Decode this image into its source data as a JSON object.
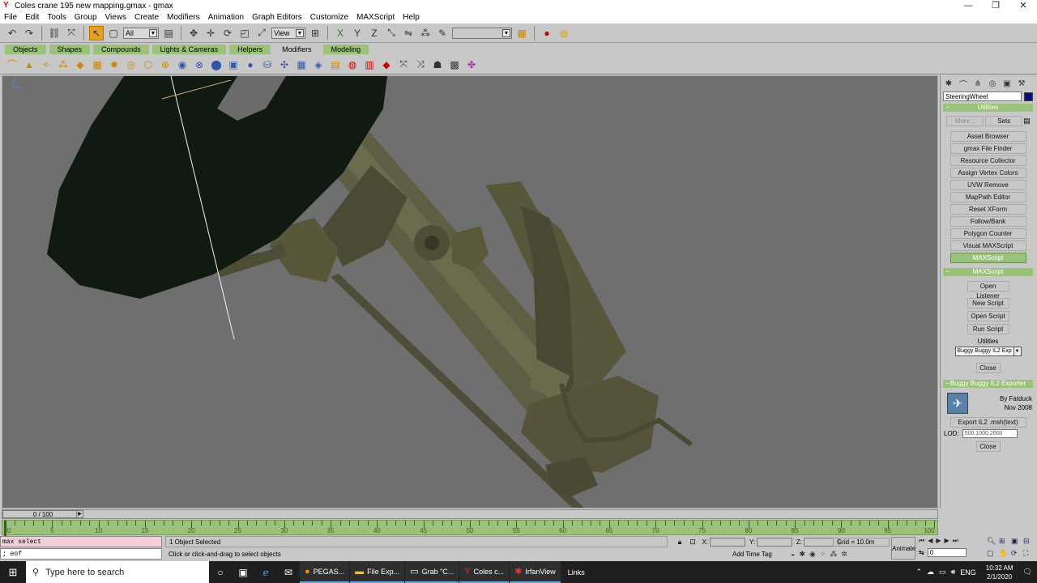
{
  "window": {
    "title": "Coles crane 195 new mapping.gmax - gmax",
    "minimize": "—",
    "restore": "❐",
    "close": "✕"
  },
  "menu": [
    "File",
    "Edit",
    "Tools",
    "Group",
    "Views",
    "Create",
    "Modifiers",
    "Animation",
    "Graph Editors",
    "Customize",
    "MAXScript",
    "Help"
  ],
  "toolbar": {
    "selection_filter": "All",
    "reference_coord": "View",
    "named_selection": ""
  },
  "tabs": [
    "Objects",
    "Shapes",
    "Compounds",
    "Lights & Cameras",
    "Helpers",
    "Modifiers",
    "Modeling"
  ],
  "active_tab": "Modifiers",
  "command_panel": {
    "object_name": "SteeringWheel",
    "object_color": "#0a0a8c",
    "utilities_rollout": "Utilities",
    "more_button": "More...",
    "sets_button": "Sets",
    "utility_buttons": [
      "Asset Browser",
      "gmax File Finder",
      "Resource Collector",
      "Assign Vertex Colors",
      "UVW Remove",
      "MapPath Editor",
      "Reset XForm",
      "Follow/Bank",
      "Polygon Counter",
      "Visual MAXScript",
      "MAXScript"
    ],
    "active_utility": "MAXScript",
    "maxscript_rollout": "MAXScript",
    "maxscript_buttons": [
      "Open Listener",
      "New Script",
      "Open Script",
      "Run Script"
    ],
    "utilities_label": "Utilities",
    "utilities_dropdown": "Buggy Buggy IL2 Exp",
    "close_button": "Close",
    "exporter_rollout": "Buggy Buggy IL2 Exporter",
    "author": "By Fatduck",
    "date": "Nov 2008",
    "export_button": "Export IL2 .msh(text)",
    "lod_label": "LOD:",
    "lod_value": "500,1000,2000",
    "exporter_close": "Close"
  },
  "timeline": {
    "frame_display": "0 / 100",
    "labels": [
      "0",
      "5",
      "10",
      "15",
      "20",
      "25",
      "30",
      "35",
      "40",
      "45",
      "50",
      "55",
      "60",
      "65",
      "70",
      "75",
      "80",
      "85",
      "90",
      "95",
      "100"
    ]
  },
  "maxscript_mini": {
    "line1": "max select",
    "line2": "; eof"
  },
  "status": {
    "selection": "1 Object Selected",
    "prompt": "Click or click-and-drag to select objects",
    "x_label": "X:",
    "y_label": "Y:",
    "z_label": "Z:",
    "grid": "Grid = 10.0m",
    "add_time_tag": "Add Time Tag",
    "animate": "Animate",
    "current_frame": "0"
  },
  "taskbar": {
    "search_placeholder": "Type here to search",
    "apps": [
      {
        "label": "PEGAS...",
        "icon": "firefox-icon"
      },
      {
        "label": "File Exp...",
        "icon": "folder-icon"
      },
      {
        "label": "Grab \"C...",
        "icon": "window-icon"
      },
      {
        "label": "Coles c...",
        "icon": "gmax-icon"
      },
      {
        "label": "IrfanView",
        "icon": "irfanview-icon"
      }
    ],
    "links": "Links",
    "language": "ENG",
    "time": "10:32 AM",
    "date": "2/1/2020"
  }
}
